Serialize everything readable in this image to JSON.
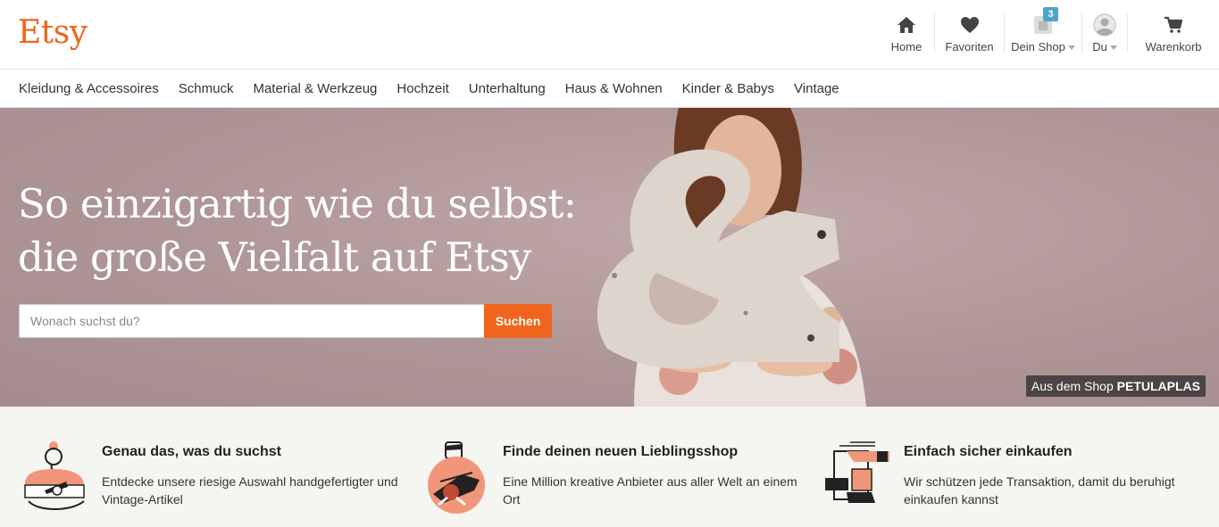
{
  "header": {
    "logo": "Etsy",
    "nav": [
      {
        "label": "Home",
        "icon": "home-icon"
      },
      {
        "label": "Favoriten",
        "icon": "heart-icon"
      },
      {
        "label": "Dein Shop",
        "icon": "shop-icon",
        "badge": "3"
      },
      {
        "label": "Du",
        "icon": "avatar-icon"
      },
      {
        "label": "Warenkorb",
        "icon": "cart-icon"
      }
    ]
  },
  "categories": [
    "Kleidung & Accessoires",
    "Schmuck",
    "Material & Werkzeug",
    "Hochzeit",
    "Unterhaltung",
    "Haus & Wohnen",
    "Kinder & Babys",
    "Vintage"
  ],
  "hero": {
    "headline_line1": "So einzigartig wie du selbst:",
    "headline_line2": "die große Vielfalt auf Etsy",
    "search_placeholder": "Wonach suchst du?",
    "search_button": "Suchen",
    "credit_prefix": "Aus dem Shop",
    "credit_shop": "PETULAPLAS"
  },
  "value_props": [
    {
      "title": "Genau das, was du suchst",
      "text": "Entdecke unsere riesige Auswahl handgefertigter und Vintage-Artikel",
      "icon": "woman-crafting-icon"
    },
    {
      "title": "Finde deinen neuen Lieblingsshop",
      "text": "Eine Million kreative Anbieter aus aller Welt an einem Ort",
      "icon": "man-knitting-icon"
    },
    {
      "title": "Einfach sicher einkaufen",
      "text": "Wir schützen jede Transaktion, damit du beruhigt einkaufen kannst",
      "icon": "handshake-box-icon"
    }
  ],
  "colors": {
    "brand": "#f1641e",
    "badge": "#4fa5c8",
    "hero_bg": "#ae9596",
    "values_bg": "#f5f5f1"
  }
}
